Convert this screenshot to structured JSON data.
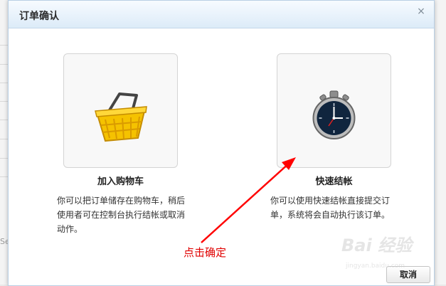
{
  "dialog": {
    "title": "订单确认",
    "close_symbol": "×",
    "options": [
      {
        "title": "加入购物车",
        "desc_lines": [
          "你可以把订单储存在购物车，稍后",
          "使用者可在控制台执行结帐或取消",
          "动作。"
        ],
        "icon": "shopping-basket-icon"
      },
      {
        "title": "快速结帐",
        "desc_lines": [
          "你可以使用快速结帐直接提交订",
          "单，系统将会自动执行该订单。"
        ],
        "icon": "stopwatch-icon"
      }
    ],
    "cancel_label": "取消"
  },
  "background": {
    "partial_text": "Se"
  },
  "annotation": {
    "text": "点击确定",
    "color": "#e00000"
  },
  "watermark": {
    "main": "Bai 经验",
    "sub": "jingyan.baidu.com"
  },
  "colors": {
    "titlebar": "#dcebf8",
    "basket": "#f5c200",
    "arrow": "#ff0000"
  }
}
